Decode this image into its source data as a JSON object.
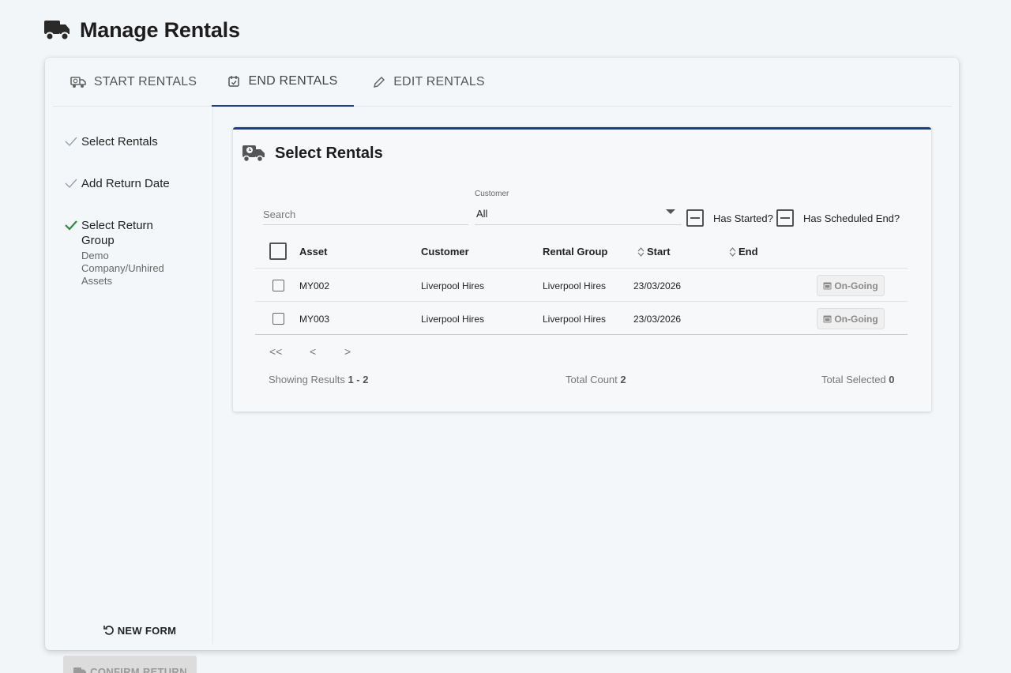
{
  "header": {
    "title": "Manage Rentals",
    "icon": "truck-icon"
  },
  "tabs": [
    {
      "label": "START RENTALS",
      "icon": "truck-clock-icon",
      "active": false
    },
    {
      "label": "END RENTALS",
      "icon": "calendar-check-icon",
      "active": true
    },
    {
      "label": "EDIT RENTALS",
      "icon": "pencil-icon",
      "active": false
    }
  ],
  "steps": [
    {
      "label": "Select Rentals",
      "state": "done"
    },
    {
      "label": "Add Return Date",
      "state": "done"
    },
    {
      "label": "Select Return Group",
      "state": "current",
      "sub": "Demo Company/Unhired Assets"
    }
  ],
  "actions": {
    "new_form": "NEW FORM",
    "confirm_return": "CONFIRM RETURN"
  },
  "panel": {
    "title": "Select Rentals",
    "search_placeholder": "Search",
    "customer_label": "Customer",
    "customer_value": "All",
    "filter_started": "Has Started?",
    "filter_scheduled_end": "Has Scheduled End?"
  },
  "table": {
    "columns": [
      "Asset",
      "Customer",
      "Rental Group",
      "Start",
      "End"
    ],
    "rows": [
      {
        "asset": "MY002",
        "customer": "Liverpool Hires",
        "group": "Liverpool Hires",
        "start": "23/03/2026",
        "status": "On-Going"
      },
      {
        "asset": "MY003",
        "customer": "Liverpool Hires",
        "group": "Liverpool Hires",
        "start": "23/03/2026",
        "status": "On-Going"
      }
    ]
  },
  "pager": {
    "first": "<<",
    "prev": "<",
    "next": ">"
  },
  "summary": {
    "showing_label": "Showing Results",
    "showing_value": "1 - 2",
    "total_label": "Total Count",
    "total_value": "2",
    "selected_label": "Total Selected",
    "selected_value": "0"
  },
  "colors": {
    "accent": "#1f3d8a",
    "check_green": "#2e8b3a",
    "background": "#f3f6f9"
  }
}
